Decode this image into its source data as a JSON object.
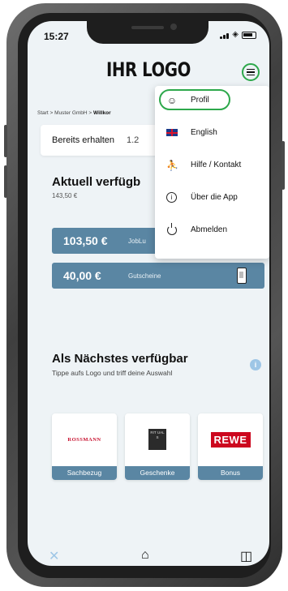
{
  "status": {
    "time": "15:27"
  },
  "header": {
    "logo": "IHR LOGO"
  },
  "breadcrumb": {
    "start": "Start",
    "sep1": ">",
    "company": "Muster GmbH",
    "sep2": ">",
    "current": "Willkor"
  },
  "received": {
    "label": "Bereits erhalten",
    "value": "1.2"
  },
  "available": {
    "title": "Aktuell verfügb",
    "amount": "143,50 €"
  },
  "budgets": [
    {
      "amount": "103,50 €",
      "label": "JobLu"
    },
    {
      "amount": "40,00 €",
      "label": "Gutscheine"
    }
  ],
  "next": {
    "title": "Als Nächstes verfügbar",
    "subtitle": "Tippe aufs Logo und triff deine Auswahl"
  },
  "partners": [
    {
      "logo": "ROSSMANN",
      "caption": "Sachbezug"
    },
    {
      "logo": "RIT UAL S",
      "caption": "Geschenke"
    },
    {
      "logo": "REWE",
      "caption": "Bonus"
    }
  ],
  "menu": {
    "items": [
      {
        "label": "Profil",
        "icon": "person-icon"
      },
      {
        "label": "English",
        "icon": "uk-flag-icon"
      },
      {
        "label": "Hilfe / Kontakt",
        "icon": "help-person-icon"
      },
      {
        "label": "Über die App",
        "icon": "info-icon"
      },
      {
        "label": "Abmelden",
        "icon": "power-icon"
      }
    ]
  },
  "colors": {
    "accent": "#5a86a3",
    "highlight": "#2da84b",
    "background": "#eef3f6"
  }
}
